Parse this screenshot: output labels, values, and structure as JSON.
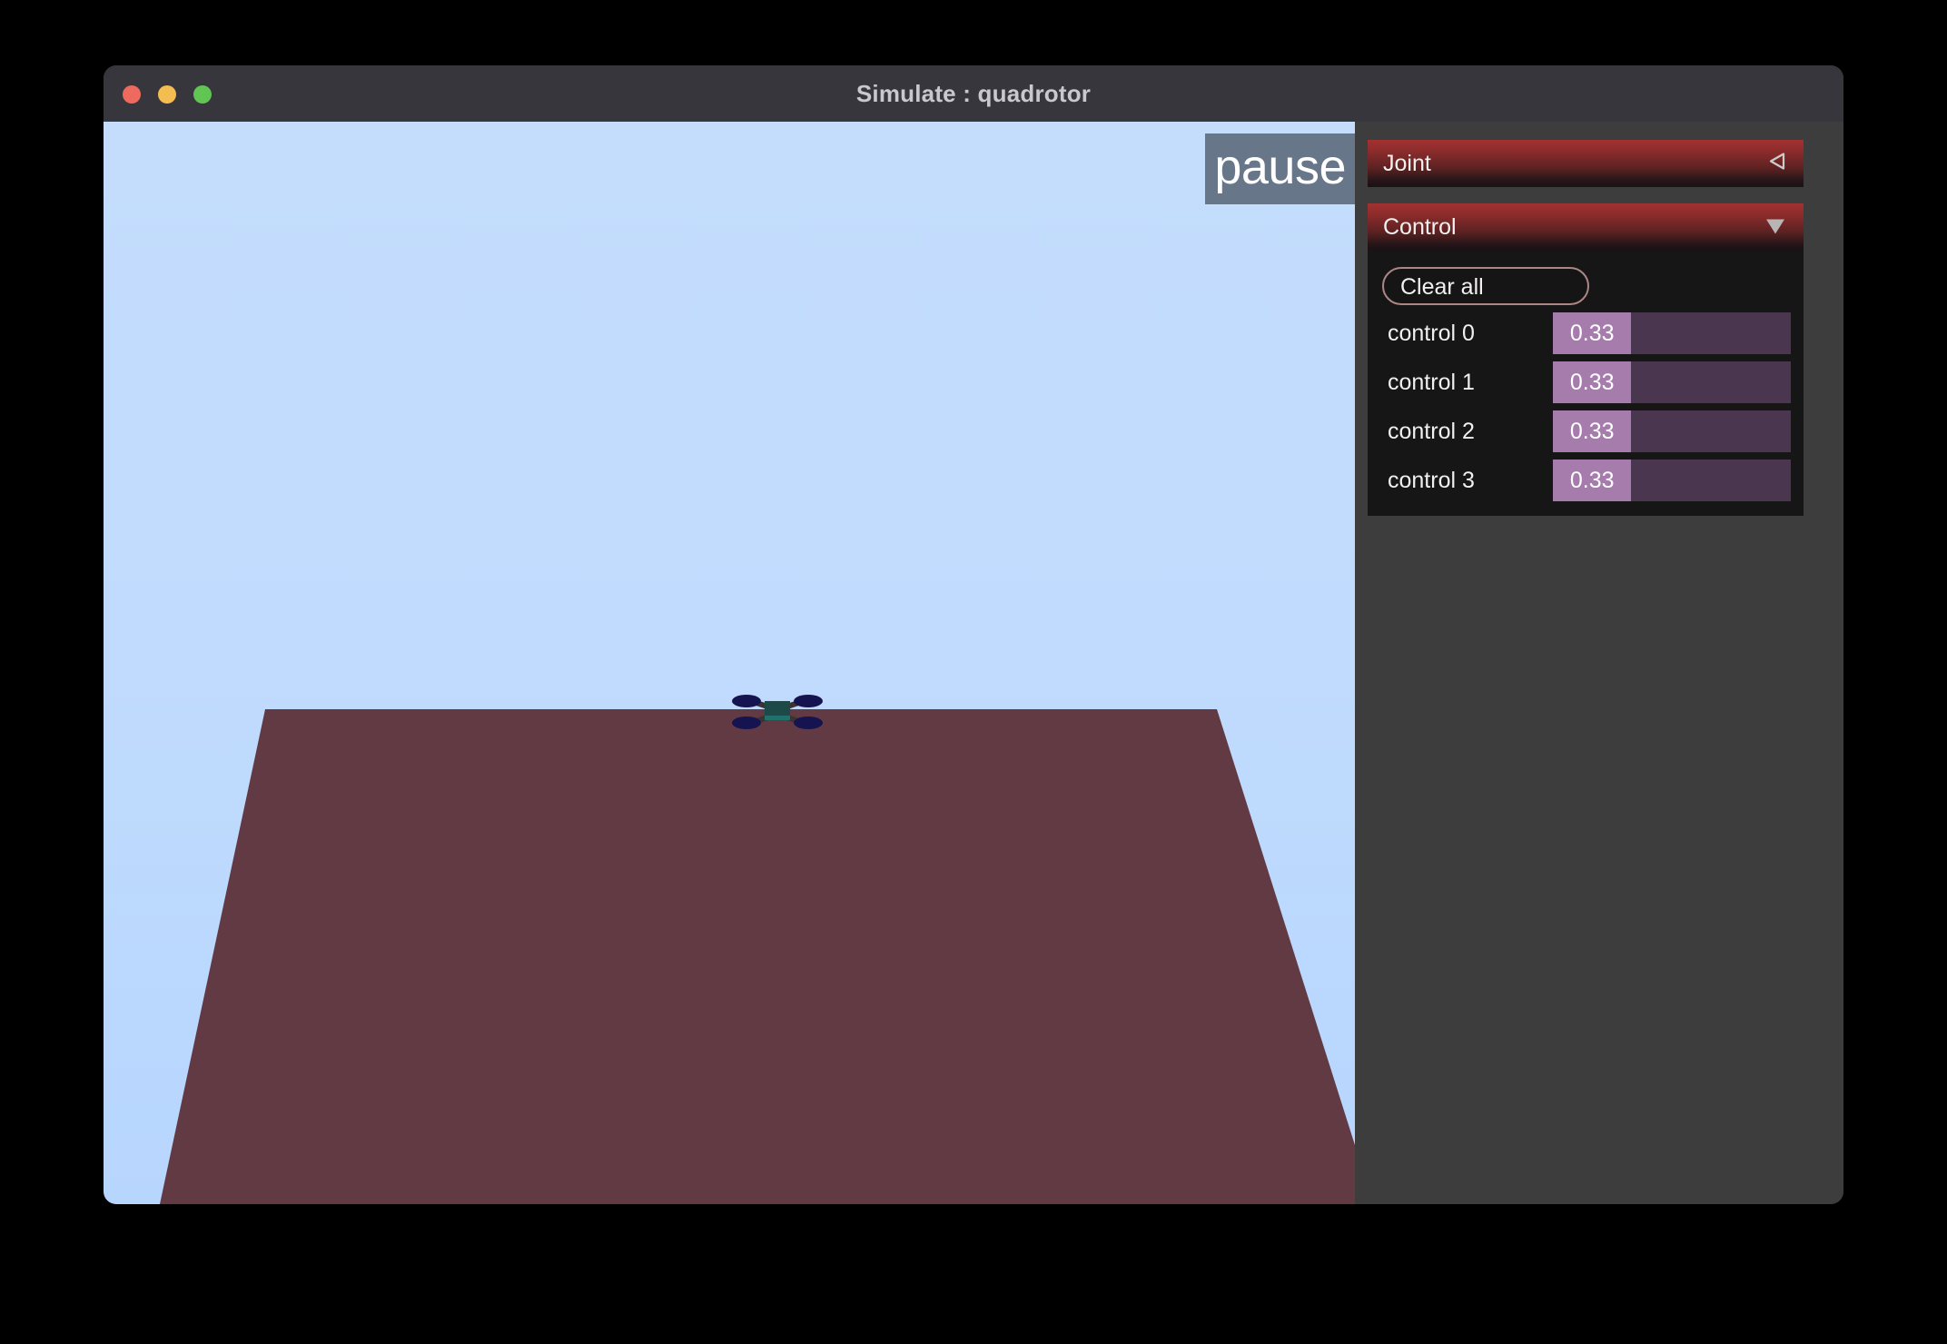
{
  "window": {
    "title": "Simulate : quadrotor",
    "traffic_lights": [
      {
        "name": "close",
        "color": "#ee6a5f"
      },
      {
        "name": "minimize",
        "color": "#f4bd4f"
      },
      {
        "name": "maximize",
        "color": "#61c554"
      }
    ]
  },
  "viewport": {
    "pause_label": "pause",
    "sky_top_color": "#c4ddfd",
    "sky_bottom_color": "#b7d6fe",
    "ground_color": "#613a43",
    "quadrotor": {
      "body_color": "#1d4a49",
      "body_color_light": "#20716c",
      "rotor_color": "#161450",
      "arm_color": "#3a3332"
    }
  },
  "panel": {
    "background_color": "#3d3d3d",
    "sections": [
      {
        "id": "joint",
        "title": "Joint",
        "collapsed": true,
        "toggle_icon": "triangle-left-icon"
      },
      {
        "id": "control",
        "title": "Control",
        "collapsed": false,
        "toggle_icon": "triangle-down-icon",
        "clear_all_label": "Clear all",
        "sliders": [
          {
            "label": "control 0",
            "value": "0.33",
            "fraction": 0.33
          },
          {
            "label": "control 1",
            "value": "0.33",
            "fraction": 0.33
          },
          {
            "label": "control 2",
            "value": "0.33",
            "fraction": 0.33
          },
          {
            "label": "control 3",
            "value": "0.33",
            "fraction": 0.33
          }
        ],
        "slider_fill_color": "#a57cab",
        "slider_track_color": "#4b3650",
        "accent_color": "#ad8686"
      }
    ]
  }
}
